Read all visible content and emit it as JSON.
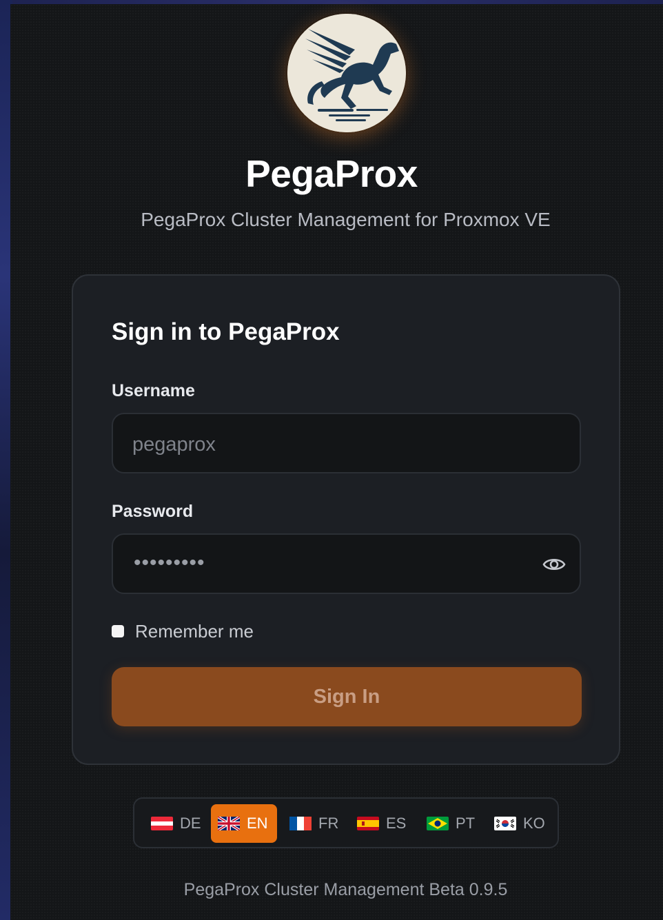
{
  "brand": {
    "title": "PegaProx",
    "subtitle": "PegaProx Cluster Management for Proxmox VE",
    "logo_icon": "pegasus-logo-icon"
  },
  "login": {
    "heading": "Sign in to PegaProx",
    "username_label": "Username",
    "username_placeholder": "pegaprox",
    "password_label": "Password",
    "password_masked": "•••••••••",
    "remember_label": "Remember me",
    "remember_checked": false,
    "submit_label": "Sign In"
  },
  "languages": {
    "selected": "EN",
    "items": [
      {
        "code": "DE",
        "flag": "austria-flag-icon"
      },
      {
        "code": "EN",
        "flag": "uk-flag-icon"
      },
      {
        "code": "FR",
        "flag": "france-flag-icon"
      },
      {
        "code": "ES",
        "flag": "spain-flag-icon"
      },
      {
        "code": "PT",
        "flag": "brazil-flag-icon"
      },
      {
        "code": "KO",
        "flag": "korea-flag-icon"
      }
    ]
  },
  "footer": {
    "text": "PegaProx Cluster Management Beta 0.9.5"
  },
  "colors": {
    "accent": "#e8700f",
    "button": "#8a4a1e",
    "background": "#141618",
    "card": "#1c1f24"
  }
}
